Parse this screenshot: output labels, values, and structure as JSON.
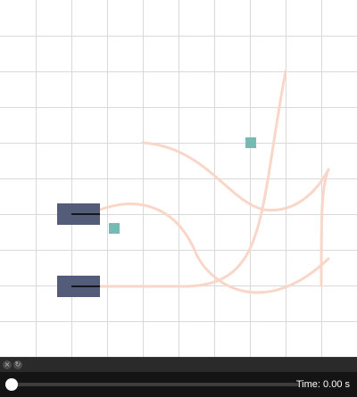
{
  "window_controls": {
    "close_icon": "close-circle-icon",
    "detach_icon": "detach-circle-icon"
  },
  "scene": {
    "background": "#ffffff",
    "grid_color": "#d9d9d9",
    "vehicle_color": "#535d7a",
    "obstacle_color": "#7ab8b3",
    "path_color": "#f9d6c8"
  },
  "playback": {
    "progress": 0.0,
    "time_text": "Time: 0.00 s"
  }
}
